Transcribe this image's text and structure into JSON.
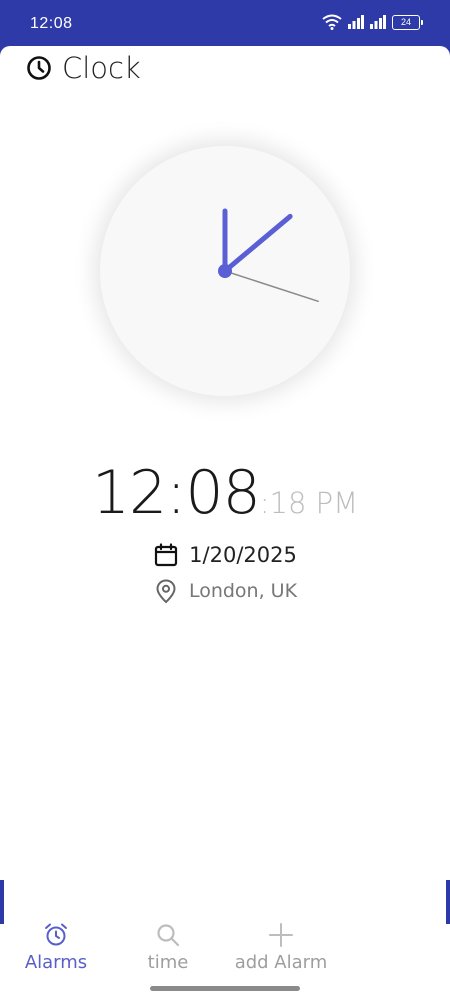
{
  "status_bar": {
    "time": "12:08",
    "battery": "24",
    "icons": [
      "wifi-icon",
      "signal-icon",
      "signal-icon",
      "battery-icon"
    ]
  },
  "header": {
    "title": "Clock",
    "icon": "clock-icon"
  },
  "analog_clock": {
    "hour": 12,
    "minute": 8,
    "second": 18,
    "hand_color": "#5a5fd6",
    "second_hand_color": "#8a8a8a"
  },
  "digital_clock": {
    "time": "12:08",
    "seconds_ampm": ":18 PM"
  },
  "date": {
    "icon": "calendar-icon",
    "text": "1/20/2025"
  },
  "location": {
    "icon": "location-pin-icon",
    "text": "London, UK"
  },
  "bottom_nav": {
    "items": [
      {
        "label": "Alarms",
        "icon": "alarm-clock-icon",
        "active": true
      },
      {
        "label": "time",
        "icon": "search-icon",
        "active": false
      },
      {
        "label": "add Alarm",
        "icon": "plus-icon",
        "active": false
      }
    ]
  },
  "colors": {
    "status_bar": "#2d3aa8",
    "accent": "#5a5fc8",
    "inactive": "#9e9e9e"
  }
}
